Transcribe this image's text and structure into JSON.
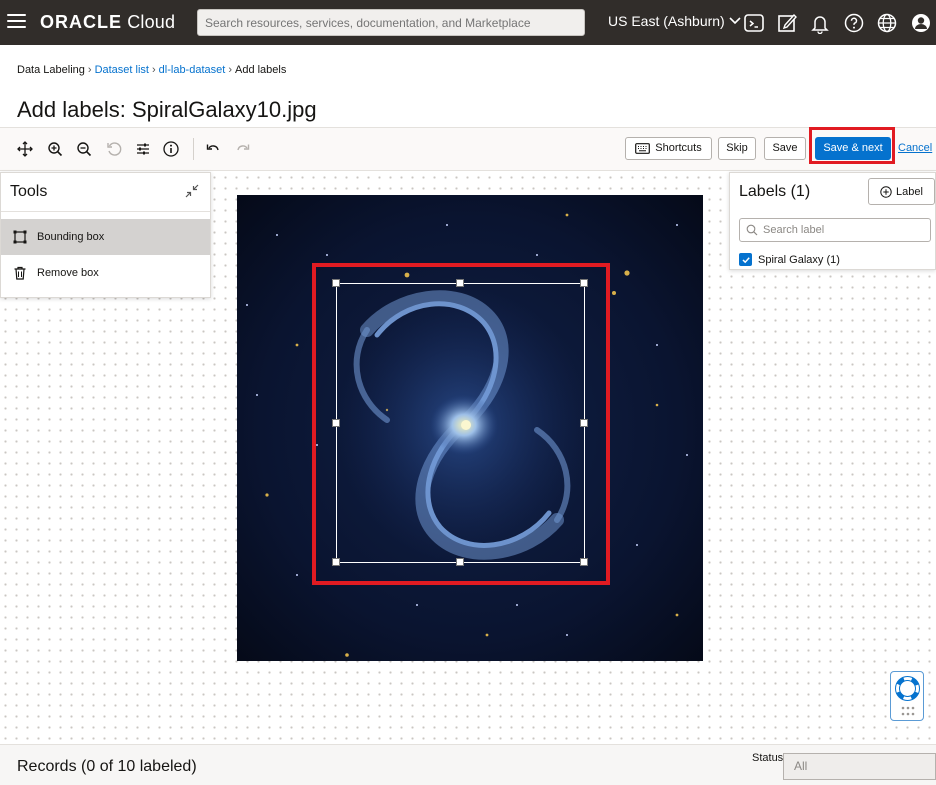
{
  "topbar": {
    "logo_brand": "ORACLE",
    "logo_product": "Cloud",
    "search_placeholder": "Search resources, services, documentation, and Marketplace",
    "region": "US East (Ashburn)",
    "icons": [
      "hamburger-menu-icon",
      "cloud-shell-icon",
      "edit-icon",
      "bell-icon",
      "help-icon",
      "globe-icon",
      "user-icon"
    ]
  },
  "breadcrumb": {
    "items": [
      {
        "label": "Data Labeling",
        "link": false
      },
      {
        "label": "Dataset list",
        "link": true
      },
      {
        "label": "dl-lab-dataset",
        "link": true
      },
      {
        "label": "Add labels",
        "link": false
      }
    ],
    "separator": "›"
  },
  "page_title": "Add labels: SpiralGalaxy10.jpg",
  "toolbar": {
    "icons": [
      "move-icon",
      "zoom-in-icon",
      "zoom-out-icon",
      "reset-icon",
      "adjust-icon",
      "info-icon",
      "undo-icon",
      "redo-icon"
    ],
    "shortcuts_label": "Shortcuts",
    "skip_label": "Skip",
    "save_label": "Save",
    "save_next_label": "Save & next",
    "cancel_label": "Cancel"
  },
  "tools_panel": {
    "title": "Tools",
    "items": [
      {
        "label": "Bounding box",
        "icon": "bounding-box-icon",
        "selected": true
      },
      {
        "label": "Remove box",
        "icon": "trash-icon",
        "selected": false
      }
    ]
  },
  "labels_panel": {
    "title": "Labels (1)",
    "add_label": "Label",
    "search_placeholder": "Search label",
    "items": [
      {
        "label": "Spiral Galaxy (1)",
        "checked": true
      }
    ]
  },
  "footer": {
    "records": "Records (0 of 10 labeled)",
    "status_label": "Status",
    "status_value": "All"
  },
  "colors": {
    "topbar": "#312d2a",
    "primary": "#0572ce",
    "highlight": "#e11b22"
  }
}
